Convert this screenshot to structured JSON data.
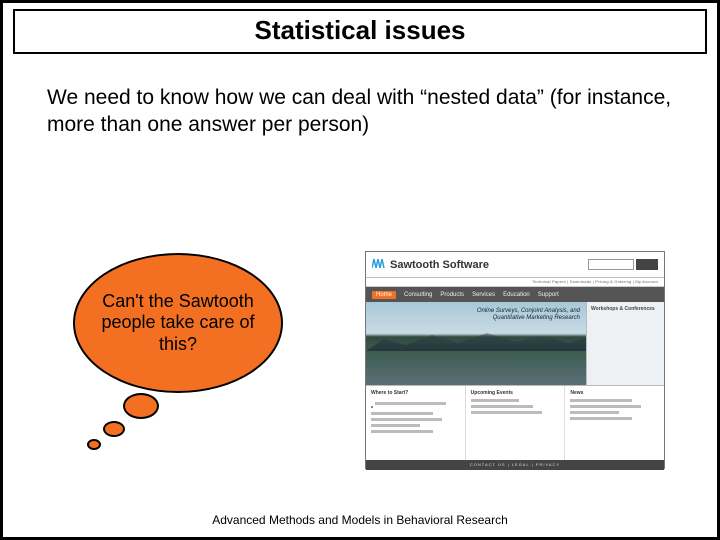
{
  "title": "Statistical issues",
  "body": "We need to know how we can deal with “nested data” (for instance, more than one answer per person)",
  "bubble": "Can't the Sawtooth people take care of this?",
  "site": {
    "brand": "Sawtooth Software",
    "toplinks": "Technical Papers | Downloads | Pricing & Ordering | My Account",
    "nav": {
      "home": "Home",
      "items": [
        "Consulting",
        "Products",
        "Services",
        "Education",
        "Support"
      ]
    },
    "hero_line1": "Online Surveys, Conjoint Analysis, and",
    "hero_line2": "Quantitative Marketing Research",
    "side_title": "Workshops & Conferences",
    "col1_title": "Where to Start?",
    "col2_title": "Upcoming Events",
    "col3_title": "News",
    "footer": "CONTACT US  |  LEGAL  |  PRIVACY"
  },
  "footer": "Advanced Methods and Models in Behavioral Research"
}
